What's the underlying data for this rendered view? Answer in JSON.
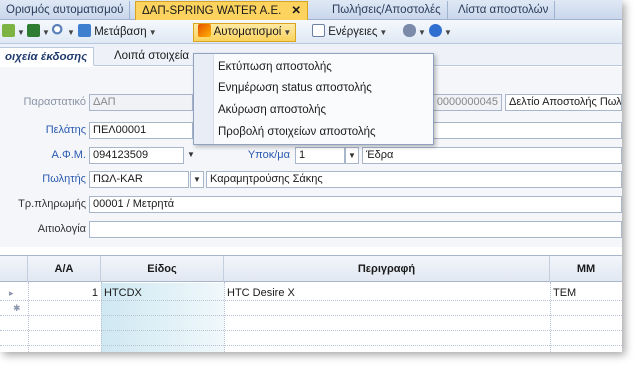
{
  "tabs": [
    {
      "label": "Ορισμός αυτοματισμού"
    },
    {
      "label": "ΔΑΠ-SPRING WATER A.E.",
      "close": "✕"
    },
    {
      "label": "Πωλήσεις/Αποστολές"
    },
    {
      "label": "Λίστα αποστολών"
    }
  ],
  "toolbar": {
    "goto_label": "Μετάβαση",
    "automations_label": "Αυτοματισμοί",
    "actions_label": "Ενέργειες"
  },
  "form_tabs": [
    "οιχεία έκδοσης",
    "Λοιπά στοιχεία"
  ],
  "form": {
    "document_label": "Παραστατικό",
    "document_value": "ΔΑΠ",
    "doc_number": "0000000045",
    "doc_type": "Δελτίο Αποστολής Πωλ",
    "customer_label": "Πελάτης",
    "customer_value": "ΠΕΛ00001",
    "afm_label": "Α.Φ.Μ.",
    "afm_value": "094123509",
    "branch_label": "Υποκ/μα",
    "branch_code": "1",
    "branch_name": "Έδρα",
    "seller_label": "Πωλητής",
    "seller_code": "ΠΩΛ-KAR",
    "seller_name": "Καραμητρούσης Σάκης",
    "payment_label": "Τρ.πληρωμής",
    "payment_value": "00001 / Μετρητά",
    "reason_label": "Αιτιολογία",
    "reason_value": ""
  },
  "grid": {
    "headers": [
      "Α/Α",
      "Είδος",
      "Περιγραφή",
      "ΜΜ"
    ],
    "rows": [
      {
        "marker": "▸",
        "aa": "1",
        "code": "HTCDX",
        "description": "HTC Desire X",
        "mm": "TEM"
      },
      {
        "marker": "✱",
        "aa": "",
        "code": "",
        "description": "",
        "mm": ""
      }
    ]
  },
  "menu": {
    "items": [
      "Εκτύπωση αποστολής",
      "Ενημέρωση status αποστολής",
      "Ακύρωση αποστολής",
      "Προβολή στοιχείων αποστολής"
    ]
  },
  "icons": [
    "new-doc-icon",
    "excel-icon",
    "search-icon",
    "calendar-icon",
    "automation-icon",
    "actions-icon",
    "user-icon",
    "help-icon"
  ],
  "colors": {
    "active_tab": "#fbd35e",
    "label_blue": "#2a5ab0",
    "code_column": "#cfe8f2"
  }
}
